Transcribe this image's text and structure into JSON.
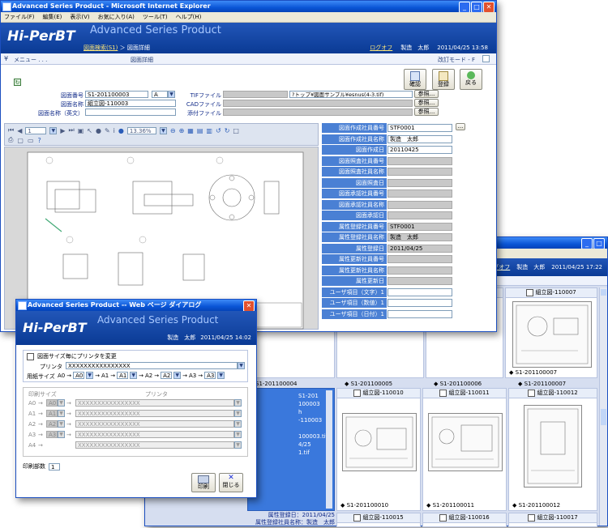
{
  "colors": {
    "accent": "#0a55d6",
    "label_blue": "#102a88",
    "link": "#1a2dd8",
    "sidepanel": "#4a80d4"
  },
  "back_window": {
    "login_user": "製造　大郎",
    "logout_link": "ログオフ",
    "datetime": "2011/04/25 17:22",
    "grid_cells": [
      {
        "title": "組立図-110007",
        "id": "S1-201100007",
        "checked": false
      },
      {
        "title": "組立図-110010",
        "id": "S1-201100010",
        "checked": false
      },
      {
        "title": "組立図-110011",
        "id": "S1-201100011",
        "checked": false
      },
      {
        "title": "組立図-110012",
        "id": "S1-201100012",
        "checked": false
      },
      {
        "title": "組立図-110015",
        "id": "",
        "checked": false
      },
      {
        "title": "組立図-110016",
        "id": "",
        "checked": false
      },
      {
        "title": "組立図-110017",
        "id": "",
        "checked": false
      }
    ],
    "top_ids": [
      "S1-201100004",
      "S1-201100005",
      "S1-201100006",
      "S1-201100007"
    ],
    "selected_lines": [
      "S1-201",
      "100003",
      "h",
      "-110003",
      "100003.tif",
      "4/25",
      "1.tif"
    ],
    "bottom_lines": [
      "属性登録日：2011/04/25",
      "属性登録社員名称：製造　太郎"
    ]
  },
  "main_window": {
    "title": "Advanced Series Product - Microsoft Internet Explorer",
    "menu": [
      "ファイル(F)",
      "編集(E)",
      "表示(V)",
      "お気に入り(A)",
      "ツール(T)",
      "ヘルプ(H)"
    ],
    "logo": "Hi-PerBT",
    "app_title": "Advanced Series Product",
    "breadcrumb_link": "図面検索(S1)",
    "breadcrumb_sep": "＞",
    "breadcrumb_current": "図面詳細",
    "logout": "ログオフ",
    "user": "製造　太郎",
    "datetime": "2011/04/25 13:58",
    "menu_toggle": "メニュー . . .",
    "page_title": "図面詳細",
    "mode": "改訂モード",
    "mode_suffix": "F",
    "actions": {
      "confirm": "確認",
      "register": "登録",
      "back": "戻る"
    },
    "form": {
      "drawing_no_label": "図面番号",
      "drawing_no": "S1-201100003",
      "revision": "A",
      "drawing_name_label": "図面名称",
      "drawing_name": "組立図-110003",
      "drawing_name_en_label": "図面名称（英文）",
      "tif_label": "TIFファイル",
      "tif_path": "?トップ¥図面サンプル¥esnus(4-3.tif)",
      "cad_label": "CADファイル",
      "attach_label": "添付ファイル",
      "browse": "参照..."
    },
    "toolbar": {
      "page": "1",
      "zoom": "13.36%"
    },
    "side_fields": [
      {
        "label": "図面作成社員番号",
        "value": "STF0001",
        "gray": false
      },
      {
        "label": "図面作成社員名称",
        "value": "製造　太郎",
        "gray": false
      },
      {
        "label": "図面作成日",
        "value": "20110425",
        "gray": false
      },
      {
        "label": "図面照査社員番号",
        "value": "",
        "gray": true
      },
      {
        "label": "図面照査社員名称",
        "value": "",
        "gray": true
      },
      {
        "label": "図面照査日",
        "value": "",
        "gray": true
      },
      {
        "label": "図面承認社員番号",
        "value": "",
        "gray": true
      },
      {
        "label": "図面承認社員名称",
        "value": "",
        "gray": true
      },
      {
        "label": "図面承認日",
        "value": "",
        "gray": true
      },
      {
        "label": "属性登録社員番号",
        "value": "STF0001",
        "gray": true
      },
      {
        "label": "属性登録社員名称",
        "value": "製造　太郎",
        "gray": true
      },
      {
        "label": "属性登録日",
        "value": "2011/04/25",
        "gray": true
      },
      {
        "label": "属性更新社員番号",
        "value": "",
        "gray": true
      },
      {
        "label": "属性更新社員名称",
        "value": "",
        "gray": true
      },
      {
        "label": "属性更新日",
        "value": "",
        "gray": true
      },
      {
        "label": "ユーザ項目（文字）1",
        "value": "",
        "gray": false
      },
      {
        "label": "ユーザ項目（数値）1",
        "value": "",
        "gray": false
      },
      {
        "label": "ユーザ項目（日付）1",
        "value": "",
        "gray": false
      }
    ],
    "more_button": "..."
  },
  "dialog": {
    "title": "Advanced Series Product -- Web ページ ダイアログ",
    "logo": "Hi-PerBT",
    "app_title": "Advanced Series Product",
    "user": "製造　太郎",
    "datetime": "2011/04/25 14:02",
    "change_printer_label": "図面サイズ毎にプリンタを変更",
    "printer_label": "プリンタ",
    "printer_value": "XXXXXXXXXXXXXXXX",
    "paper_size_label": "用紙サイズ",
    "paper_map": [
      {
        "from": "A0",
        "to": "A0"
      },
      {
        "from": "A1",
        "to": "A1"
      },
      {
        "from": "A2",
        "to": "A2"
      },
      {
        "from": "A3",
        "to": "A3"
      }
    ],
    "print_size_header": "印刷サイズ",
    "printer_header": "プリンタ",
    "size_rows": [
      {
        "size": "A0",
        "sel": "A0",
        "printer": "XXXXXXXXXXXXXXXX"
      },
      {
        "size": "A1",
        "sel": "A1",
        "printer": "XXXXXXXXXXXXXXXX"
      },
      {
        "size": "A2",
        "sel": "A2",
        "printer": "XXXXXXXXXXXXXXXX"
      },
      {
        "size": "A3",
        "sel": "A3",
        "printer": "XXXXXXXXXXXXXXXX"
      },
      {
        "size": "A4",
        "sel": "",
        "printer": "XXXXXXXXXXXXXXXX"
      }
    ],
    "copies_label": "印刷部数",
    "copies_value": "1",
    "print_button": "印刷",
    "close_button": "閉じる"
  }
}
